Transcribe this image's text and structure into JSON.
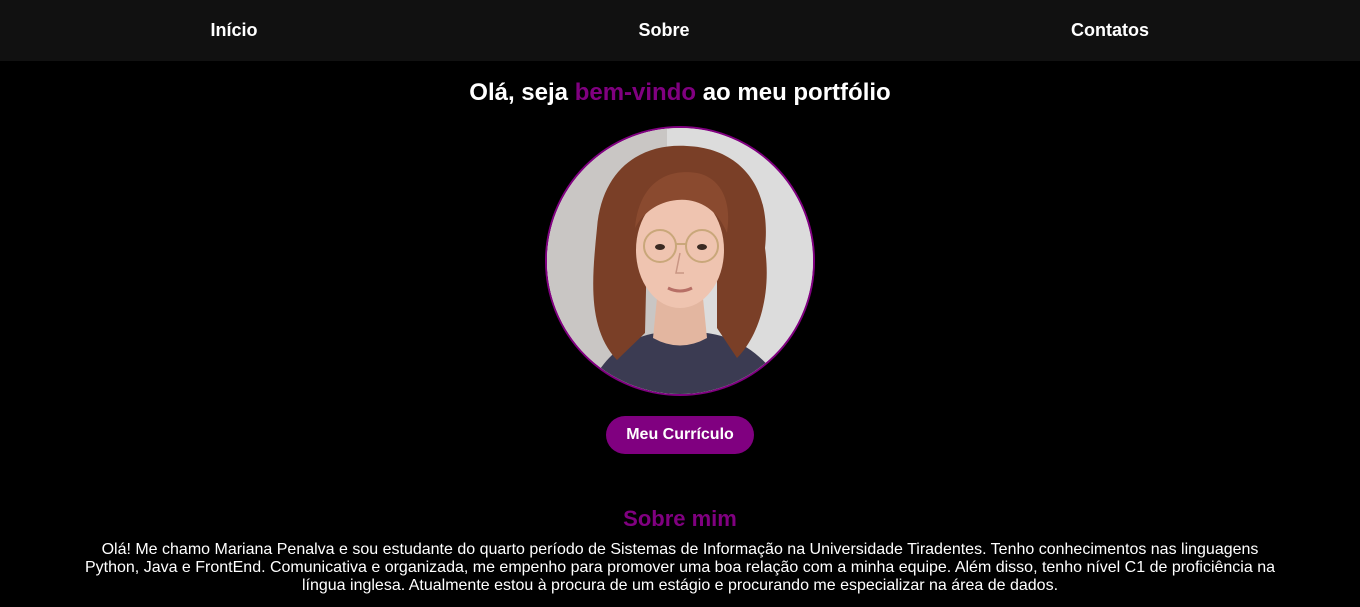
{
  "nav": {
    "items": [
      {
        "label": "Início"
      },
      {
        "label": "Sobre"
      },
      {
        "label": "Contatos"
      }
    ]
  },
  "hero": {
    "title_prefix": "Olá, seja ",
    "title_accent": "bem-vindo",
    "title_suffix": " ao meu portfólio",
    "button_label": "Meu Currículo"
  },
  "about": {
    "title": "Sobre mim",
    "text": "Olá! Me chamo Mariana Penalva e sou estudante do quarto período de Sistemas de Informação na Universidade Tiradentes. Tenho conhecimentos nas linguagens Python, Java e FrontEnd. Comunicativa e organizada, me empenho para promover uma boa relação com a minha equipe. Além disso, tenho nível C1 de proficiência na língua inglesa. Atualmente estou à procura de um estágio e procurando me especializar na área de dados."
  },
  "colors": {
    "accent": "#800080",
    "background": "#000000",
    "navbar": "#111111",
    "text": "#ffffff"
  }
}
